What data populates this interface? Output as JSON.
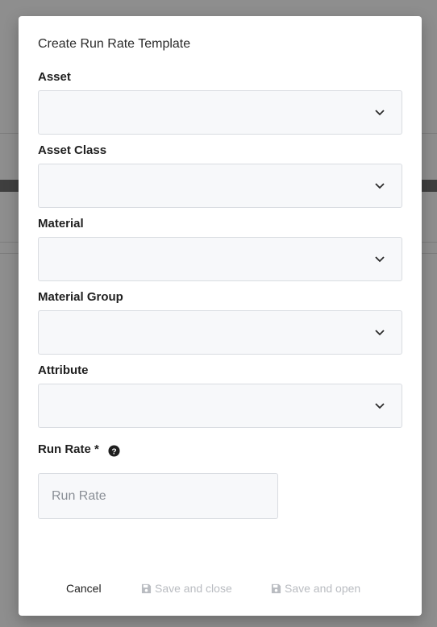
{
  "dialog": {
    "title": "Create Run Rate Template"
  },
  "fields": {
    "asset": {
      "label": "Asset",
      "value": ""
    },
    "asset_class": {
      "label": "Asset Class",
      "value": ""
    },
    "material": {
      "label": "Material",
      "value": ""
    },
    "material_group": {
      "label": "Material Group",
      "value": ""
    },
    "attribute": {
      "label": "Attribute",
      "value": ""
    },
    "run_rate": {
      "label": "Run Rate *",
      "placeholder": "Run Rate",
      "value": ""
    }
  },
  "footer": {
    "cancel_label": "Cancel",
    "save_close_label": "Save and close",
    "save_open_label": "Save and open"
  },
  "colors": {
    "disabled_text": "#b9bcc1",
    "field_bg": "#f7f8fa",
    "backdrop": "#8e8e8e"
  },
  "icons": {
    "select_chevron": "chevron-down-icon",
    "help": "question-circle-icon",
    "save": "floppy-disk-icon"
  }
}
